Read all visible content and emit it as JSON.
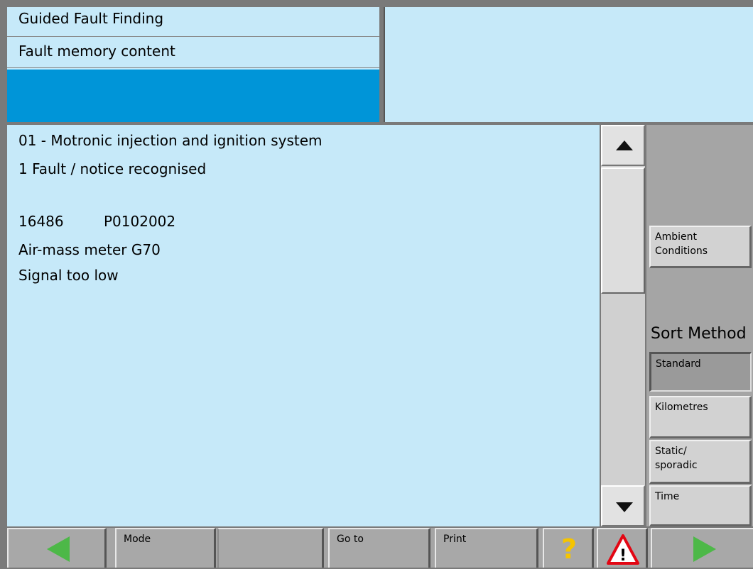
{
  "header": {
    "title": "Guided Fault Finding",
    "subtitle": "Fault memory content"
  },
  "content": {
    "lines": [
      "01 - Motronic injection and ignition system",
      "1 Fault / notice recognised",
      "16486",
      "P0102002",
      "Air-mass meter G70",
      "Signal too low"
    ]
  },
  "side": {
    "ambient_line1": "Ambient",
    "ambient_line2": "Conditions",
    "sort_label": "Sort Method",
    "sort_options": [
      "Standard",
      "Kilometres",
      "Static/",
      "sporadic",
      "Time"
    ]
  },
  "toolbar": {
    "mode": "Mode",
    "goto": "Go to",
    "print": "Print",
    "help": "?",
    "warning": "!"
  },
  "colors": {
    "panel_bg": "#c6e9f9",
    "band_blue": "#0095d8",
    "arrow_green": "#4db848",
    "help_yellow": "#f5c400",
    "warning_red": "#e30613"
  }
}
